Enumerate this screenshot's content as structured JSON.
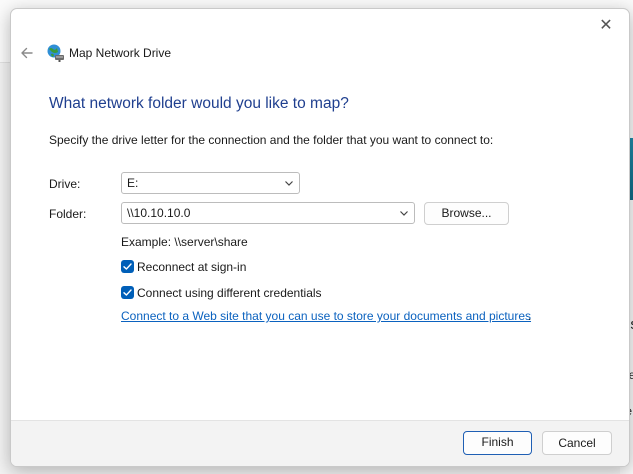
{
  "window": {
    "title": "Map Network Drive",
    "close_glyph": "✕"
  },
  "heading": "What network folder would you like to map?",
  "instructions": "Specify the drive letter for the connection and the folder that you want to connect to:",
  "drive": {
    "label": "Drive:",
    "value": "E:"
  },
  "folder": {
    "label": "Folder:",
    "value": "\\\\10.10.10.0",
    "browse_label": "Browse..."
  },
  "example_text": "Example: \\\\server\\share",
  "options": {
    "reconnect": {
      "label": "Reconnect at sign-in",
      "checked": true
    },
    "credentials": {
      "label": "Connect using different credentials",
      "checked": true
    }
  },
  "link_text": "Connect to a Web site that you can use to store your documents and pictures",
  "link_suffix": ".",
  "footer": {
    "finish_label": "Finish",
    "cancel_label": "Cancel"
  },
  "background": {
    "fragments": [
      "ns",
      "ne",
      "o",
      "te"
    ]
  },
  "colors": {
    "heading": "#1f3f8f",
    "checkbox": "#005fb8",
    "link": "#0b62bf",
    "accent": "#1f5fb4"
  }
}
